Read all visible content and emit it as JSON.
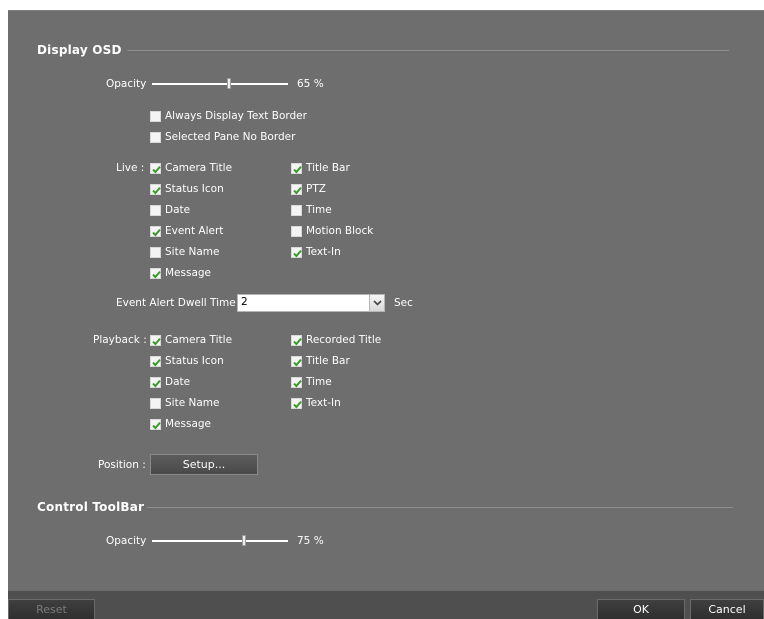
{
  "display_osd": {
    "title": "Display OSD",
    "opacity_label": "Opacity",
    "opacity_value": "65 %",
    "opacity_fraction": 0.57,
    "always_display_text_border": {
      "label": "Always Display Text Border",
      "checked": false
    },
    "selected_pane_no_border": {
      "label": "Selected Pane No Border",
      "checked": false
    },
    "live": {
      "label": "Live :",
      "items": [
        {
          "label": "Camera Title",
          "checked": true
        },
        {
          "label": "Title Bar",
          "checked": true
        },
        {
          "label": "Status Icon",
          "checked": true
        },
        {
          "label": "PTZ",
          "checked": true
        },
        {
          "label": "Date",
          "checked": false
        },
        {
          "label": "Time",
          "checked": false
        },
        {
          "label": "Event Alert",
          "checked": true
        },
        {
          "label": "Motion Block",
          "checked": false
        },
        {
          "label": "Site Name",
          "checked": false
        },
        {
          "label": "Text-In",
          "checked": true
        },
        {
          "label": "Message",
          "checked": true
        }
      ]
    },
    "event_alert_dwell": {
      "label": "Event Alert Dwell Time :",
      "value": "2",
      "unit": "Sec"
    },
    "playback": {
      "label": "Playback :",
      "items": [
        {
          "label": "Camera Title",
          "checked": true
        },
        {
          "label": "Recorded Title",
          "checked": true
        },
        {
          "label": "Status Icon",
          "checked": true
        },
        {
          "label": "Title Bar",
          "checked": true
        },
        {
          "label": "Date",
          "checked": true
        },
        {
          "label": "Time",
          "checked": true
        },
        {
          "label": "Site Name",
          "checked": false
        },
        {
          "label": "Text-In",
          "checked": true
        },
        {
          "label": "Message",
          "checked": true
        }
      ]
    },
    "position": {
      "label": "Position :",
      "button": "Setup..."
    }
  },
  "control_toolbar": {
    "title": "Control ToolBar",
    "opacity_label": "Opacity",
    "opacity_value": "75 %",
    "opacity_fraction": 0.68
  },
  "footer": {
    "reset": "Reset",
    "ok": "OK",
    "cancel": "Cancel"
  },
  "colors": {
    "panel": "#6e6e6e",
    "check": "#3a9a2a",
    "footer": "#4f4f4f"
  }
}
